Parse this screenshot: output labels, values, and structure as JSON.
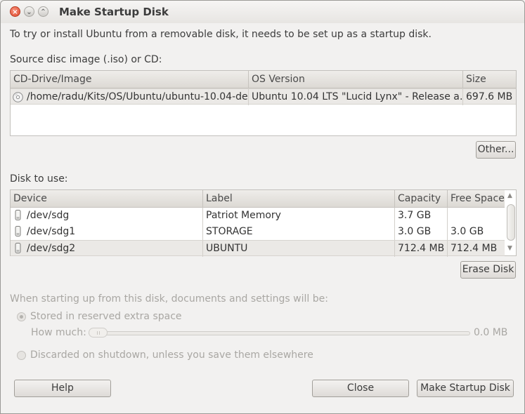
{
  "window": {
    "title": "Make Startup Disk"
  },
  "intro": "To try or install Ubuntu from a removable disk, it needs to be set up as a startup disk.",
  "source": {
    "label": "Source disc image (.iso) or CD:",
    "columns": [
      "CD-Drive/Image",
      "OS Version",
      "Size"
    ],
    "rows": [
      {
        "icon": "cd-icon",
        "image": "/home/radu/Kits/OS/Ubuntu/ubuntu-10.04-des…",
        "os_version": "Ubuntu 10.04 LTS \"Lucid Lynx\" - Release a…",
        "size": "697.6 MB"
      }
    ],
    "other_button": "Other..."
  },
  "disk": {
    "label": "Disk to use:",
    "columns": [
      "Device",
      "Label",
      "Capacity",
      "Free Space"
    ],
    "rows": [
      {
        "icon": "usb-drive-icon",
        "device": "/dev/sdg",
        "label": "Patriot Memory",
        "capacity": "3.7 GB",
        "free": ""
      },
      {
        "icon": "usb-drive-icon",
        "device": "/dev/sdg1",
        "label": "STORAGE",
        "capacity": "3.0 GB",
        "free": "3.0 GB"
      },
      {
        "icon": "usb-drive-icon",
        "device": "/dev/sdg2",
        "label": "UBUNTU",
        "capacity": "712.4 MB",
        "free": "712.4 MB"
      }
    ],
    "erase_button": "Erase Disk"
  },
  "persistence": {
    "heading": "When starting up from this disk, documents and settings will be:",
    "option_stored": "Stored in reserved extra space",
    "how_much_label": "How much:",
    "how_much_value": "0.0 MB",
    "slider_fraction": 0,
    "option_discarded": "Discarded on shutdown, unless you save them elsewhere"
  },
  "buttons": {
    "help": "Help",
    "close": "Close",
    "make": "Make Startup Disk"
  },
  "colors": {
    "window_bg": "#f2f1f0",
    "close_button": "#df4b2f",
    "disabled_text": "#a9a7a3"
  }
}
